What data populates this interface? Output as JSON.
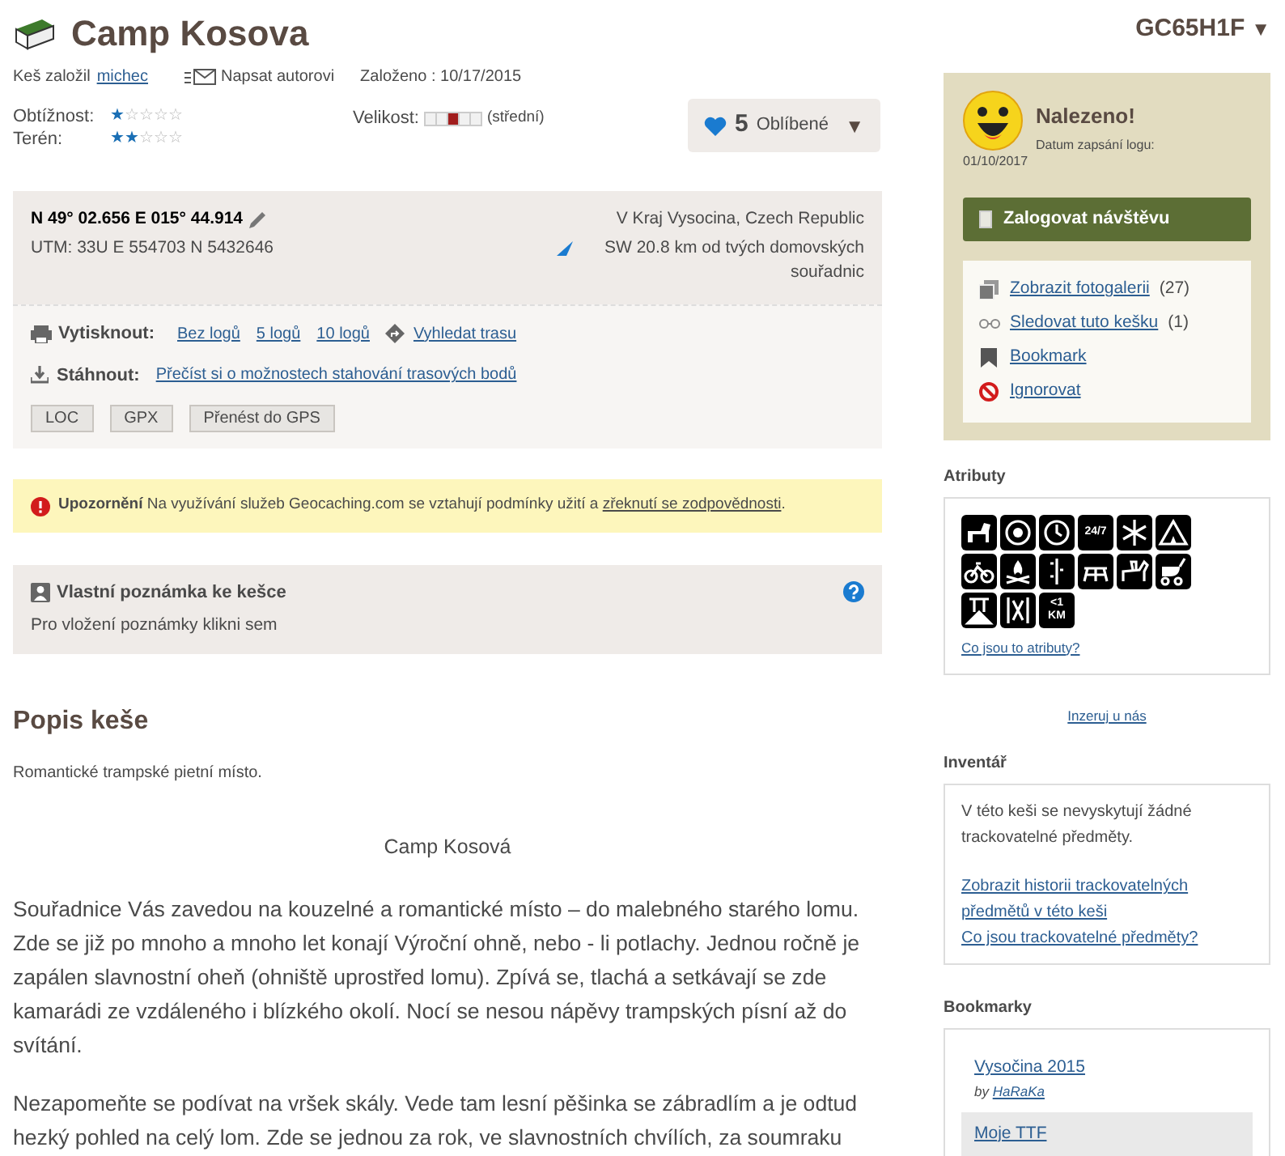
{
  "header": {
    "title": "Camp Kosova",
    "code": "GC65H1F",
    "code_caret": "▼",
    "owner_label": "Keš založil",
    "owner": "michec",
    "message_link": "Napsat autorovi",
    "hidden_date": "Založeno : 10/17/2015"
  },
  "ratings": [
    {
      "label": "Obtížnost:",
      "stars": 1
    },
    {
      "label": "Terén:",
      "stars": 2
    }
  ],
  "size": {
    "label": "Velikost:",
    "value": "(střední)",
    "segments": [
      {
        "selected": false
      },
      {
        "selected": false
      },
      {
        "selected": true
      },
      {
        "selected": false
      },
      {
        "selected": false
      }
    ]
  },
  "favorites": {
    "count": "5",
    "label": "Oblíbené",
    "caret": "▼"
  },
  "coordinates": {
    "value": "N 49° 02.656 E 015° 44.914",
    "utm": "UTM: 33U E 554703 N 5432646",
    "region": "V Kraj Vysocina, Czech Republic",
    "distance": "SW 20.8 km od tvých domovských souřadnic"
  },
  "print": {
    "label": "Vytisknout:",
    "links": [
      "Bez logů",
      "5 logů",
      "10 logů"
    ],
    "route_link": "Vyhledat trasu"
  },
  "download": {
    "label": "Stáhnout:",
    "link": "Přečíst si o možnostech stahování trasových bodů",
    "buttons": [
      "LOC",
      "GPX",
      "Přenést do GPS"
    ]
  },
  "warning": {
    "title": "Upozornění",
    "text": "Na využívání služeb Geocaching.com se vztahují podmínky užití a",
    "link": "zřeknutí se zodpovědnosti",
    "end": "."
  },
  "note": {
    "title": "Vlastní poznámka ke kešce",
    "text": "Pro vložení poznámky klikni sem"
  },
  "description": {
    "heading": "Popis keše",
    "summary": "Romantické trampské pietní místo.",
    "subtitle": "Camp Kosová",
    "paragraphs": [
      "Souřadnice Vás zavedou na kouzelné a romantické místo – do malebného starého lomu. Zde se již po mnoho a mnoho let konají Výroční ohně, nebo - li potlachy. Jednou ročně je zapálen slavnostní oheň (ohniště uprostřed lomu). Zpívá se, tlachá a setkávají se zde kamarádi ze vzdáleného i blízkého okolí. Nocí se nesou nápěvy trampských písní až do svítání.",
      "Nezapomeňte se podívat na vršek skály. Vede tam lesní pěšinka se zábradlím a je odtud hezký pohled na celý lom. Zde se jednou za rok, ve slavnostních chvílích, za soumraku"
    ]
  },
  "log_panel": {
    "status": "Nalezeno!",
    "date_label": "Datum zapsání logu:",
    "date": "01/10/2017",
    "button": "Zalogovat návštěvu",
    "actions": [
      {
        "kind": "gallery",
        "link": "Zobrazit fotogalerii",
        "count": "(27)"
      },
      {
        "kind": "watch",
        "link": "Sledovat tuto kešku",
        "count": "(1)"
      },
      {
        "kind": "bookmark",
        "link": "Bookmark"
      },
      {
        "kind": "ignore",
        "link": "Ignorovat"
      }
    ]
  },
  "attributes": {
    "heading": "Atributy",
    "icons": [
      {
        "kind": "dog"
      },
      {
        "kind": "wheel"
      },
      {
        "kind": "clock"
      },
      {
        "kind": "text",
        "label": "24/7"
      },
      {
        "kind": "snow"
      },
      {
        "kind": "tent"
      },
      {
        "kind": "bike"
      },
      {
        "kind": "fire"
      },
      {
        "kind": "rope"
      },
      {
        "kind": "picnic"
      },
      {
        "kind": "horse"
      },
      {
        "kind": "stroller"
      },
      {
        "kind": "tower"
      },
      {
        "kind": "arrows"
      },
      {
        "kind": "text",
        "label": "<1 KM"
      }
    ],
    "link": "Co jsou to atributy?"
  },
  "ad_link": "Inzeruj u nás",
  "inventory": {
    "heading": "Inventář",
    "text": "V této keši se nevyskytují žádné trackovatelné předměty.",
    "links": [
      "Zobrazit historii trackovatelných předmětů v této keši",
      "Co jsou trackovatelné předměty?"
    ]
  },
  "bookmarks": {
    "heading": "Bookmarky",
    "items": [
      {
        "title": "Vysočina 2015",
        "by": "by",
        "author": "HaRaKa",
        "selected": false
      },
      {
        "title": "Moje TTF",
        "selected": true
      }
    ]
  }
}
